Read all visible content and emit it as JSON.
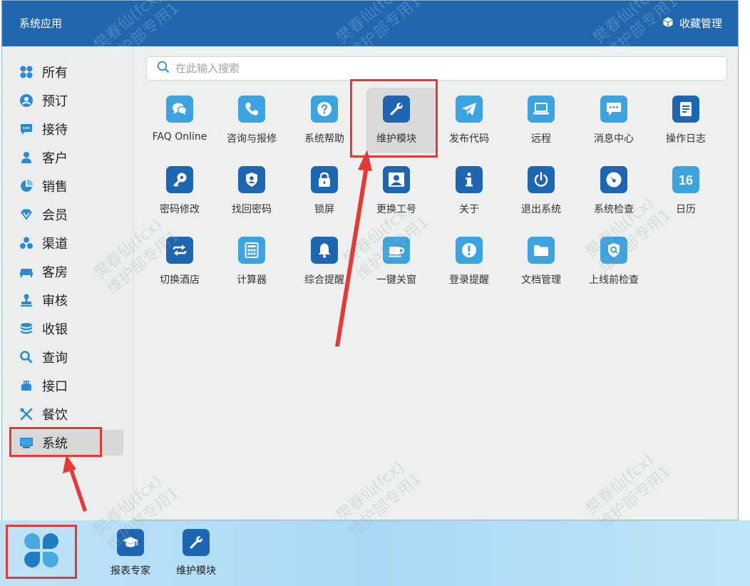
{
  "window": {
    "title": "系统应用",
    "fav_manage_label": "收藏管理"
  },
  "search": {
    "placeholder": "在此输入搜索"
  },
  "sidebar": {
    "items": [
      {
        "label": "所有",
        "icon": "grid-icon"
      },
      {
        "label": "预订",
        "icon": "user-circle-icon"
      },
      {
        "label": "接待",
        "icon": "chat-icon"
      },
      {
        "label": "客户",
        "icon": "person-icon"
      },
      {
        "label": "销售",
        "icon": "pie-chart-icon"
      },
      {
        "label": "会员",
        "icon": "diamond-icon"
      },
      {
        "label": "渠道",
        "icon": "cluster-icon"
      },
      {
        "label": "客房",
        "icon": "bed-icon"
      },
      {
        "label": "审核",
        "icon": "stamp-icon"
      },
      {
        "label": "收银",
        "icon": "coins-icon"
      },
      {
        "label": "查询",
        "icon": "search-icon"
      },
      {
        "label": "接口",
        "icon": "plug-icon"
      },
      {
        "label": "餐饮",
        "icon": "utensils-icon"
      },
      {
        "label": "系统",
        "icon": "monitor-icon"
      }
    ],
    "active": "系统"
  },
  "apps": [
    {
      "label": "FAQ Online",
      "icon": "faq-chat-icon",
      "tone": "light"
    },
    {
      "label": "咨询与报修",
      "icon": "phone-icon",
      "tone": "light"
    },
    {
      "label": "系统帮助",
      "icon": "help-icon",
      "tone": "light"
    },
    {
      "label": "维护模块",
      "icon": "wrench-icon",
      "tone": "dark",
      "selected": true
    },
    {
      "label": "发布代码",
      "icon": "paper-plane-icon",
      "tone": "light"
    },
    {
      "label": "远程",
      "icon": "laptop-icon",
      "tone": "light"
    },
    {
      "label": "消息中心",
      "icon": "message-icon",
      "tone": "light"
    },
    {
      "label": "操作日志",
      "icon": "log-icon",
      "tone": "dark"
    },
    {
      "label": "密码修改",
      "icon": "key-icon",
      "tone": "dark"
    },
    {
      "label": "找回密码",
      "icon": "shield-user-icon",
      "tone": "dark"
    },
    {
      "label": "锁屏",
      "icon": "lock-icon",
      "tone": "dark"
    },
    {
      "label": "更换工号",
      "icon": "badge-icon",
      "tone": "dark"
    },
    {
      "label": "关于",
      "icon": "info-icon",
      "tone": "dark"
    },
    {
      "label": "退出系统",
      "icon": "power-icon",
      "tone": "dark"
    },
    {
      "label": "系统检查",
      "icon": "gauge-icon",
      "tone": "dark"
    },
    {
      "label": "日历",
      "icon": "calendar-icon",
      "tone": "light",
      "icon_text": "16"
    },
    {
      "label": "切换酒店",
      "icon": "swap-icon",
      "tone": "dark"
    },
    {
      "label": "计算器",
      "icon": "calculator-icon",
      "tone": "light"
    },
    {
      "label": "综合提醒",
      "icon": "bell-icon",
      "tone": "dark"
    },
    {
      "label": "一键关窗",
      "icon": "coffee-icon",
      "tone": "light"
    },
    {
      "label": "登录提醒",
      "icon": "alert-icon",
      "tone": "light"
    },
    {
      "label": "文档管理",
      "icon": "folder-icon",
      "tone": "light"
    },
    {
      "label": "上线前检查",
      "icon": "shield-search-icon",
      "tone": "light"
    }
  ],
  "taskbar": {
    "start_icon": "clover-start-icon",
    "items": [
      {
        "label": "报表专家",
        "icon": "graduation-cap-icon"
      },
      {
        "label": "维护模块",
        "icon": "wrench-icon"
      }
    ]
  },
  "watermark": {
    "line1": "樊春仙(fcx)",
    "line2": "维护部专用1"
  },
  "colors": {
    "titlebar": "#2067ae",
    "icon_light": "#3aa3e0",
    "icon_dark": "#1e66b1",
    "highlight": "#e53935",
    "taskbar": "#a9d9f6"
  }
}
